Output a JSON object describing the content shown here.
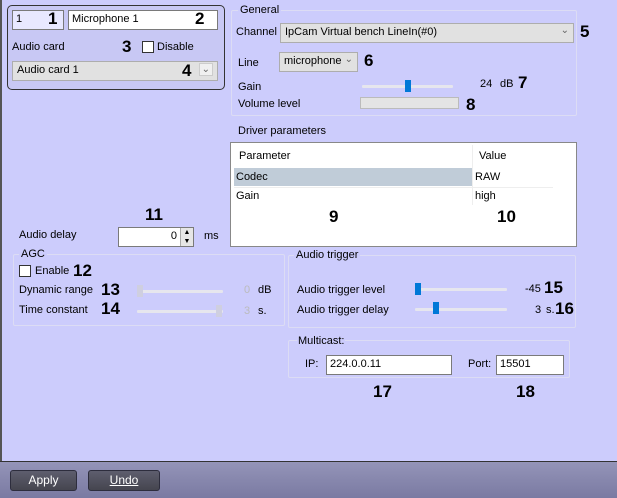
{
  "top": {
    "id": "1",
    "name": "Microphone 1",
    "audio_card_label": "Audio card",
    "disable_label": "Disable",
    "audio_card_value": "Audio card 1"
  },
  "general": {
    "title": "General",
    "channel_label": "Channel",
    "channel_value": "IpCam Virtual bench  LineIn(#0)",
    "line_label": "Line",
    "line_value": "microphone",
    "gain_label": "Gain",
    "gain_value": "24",
    "gain_unit": "dB",
    "gain_fraction": 0.5,
    "volume_label": "Volume level",
    "volume_fraction": 0
  },
  "driver": {
    "title": "Driver parameters",
    "columns": [
      "Parameter",
      "Value"
    ],
    "rows": [
      {
        "param": "Codec",
        "value": "RAW"
      },
      {
        "param": "Gain",
        "value": "high"
      }
    ]
  },
  "delay": {
    "label": "Audio delay",
    "value": "0",
    "unit": "ms"
  },
  "agc": {
    "title": "AGC",
    "enable_label": "Enable",
    "dynamic_label": "Dynamic range",
    "dynamic_value": "0",
    "dynamic_unit": "dB",
    "time_label": "Time constant",
    "time_value": "3",
    "time_unit": "s."
  },
  "trigger": {
    "title": "Audio trigger",
    "level_label": "Audio trigger level",
    "level_value": "-45",
    "delay_label": "Audio trigger delay",
    "delay_value": "3",
    "delay_unit": "s."
  },
  "multicast": {
    "title": "Multicast:",
    "ip_label": "IP:",
    "ip_value": "224.0.0.11",
    "port_label": "Port:",
    "port_value": "15501"
  },
  "footer": {
    "apply": "Apply",
    "undo": "Undo"
  },
  "callouts": [
    "1",
    "2",
    "3",
    "4",
    "5",
    "6",
    "7",
    "8",
    "9",
    "10",
    "11",
    "12",
    "13",
    "14",
    "15",
    "16",
    "17",
    "18"
  ]
}
